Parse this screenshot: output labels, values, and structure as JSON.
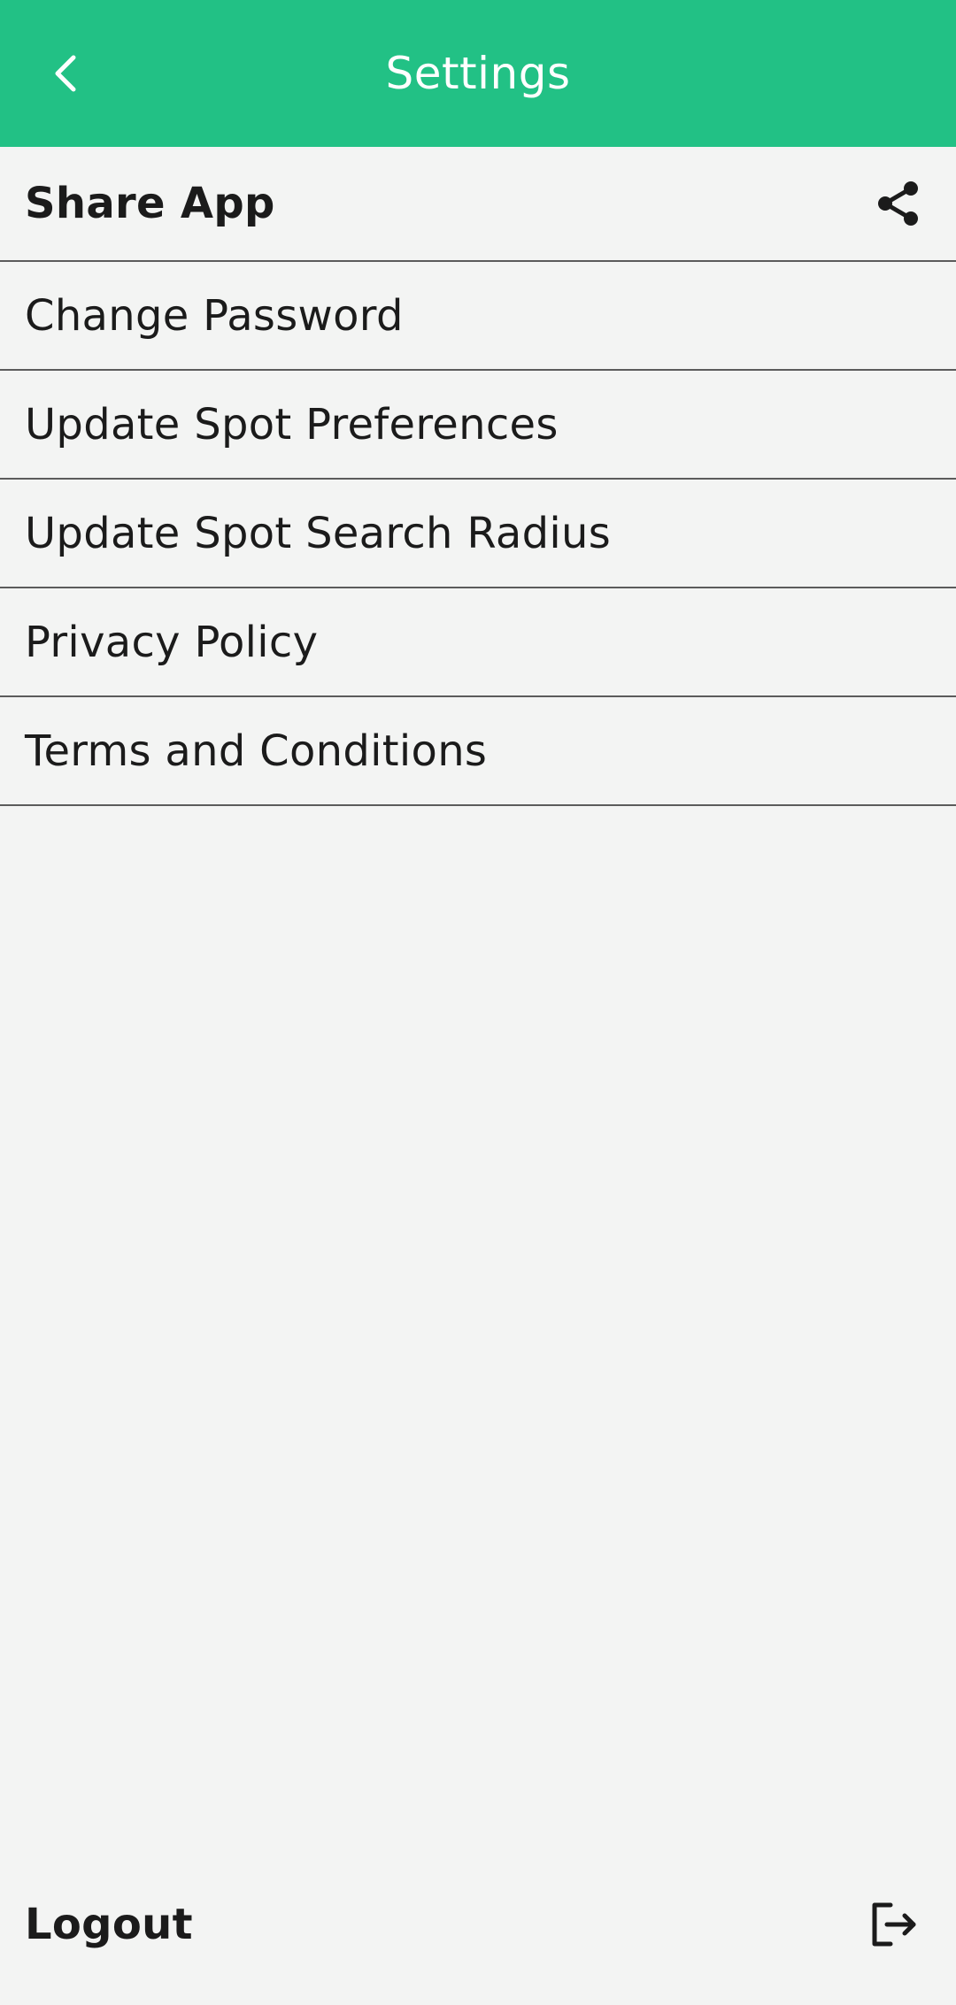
{
  "header": {
    "title": "Settings",
    "back_icon": "chevron-left-icon",
    "background_color": "#22c185"
  },
  "settings": {
    "items": [
      {
        "label": "Share App",
        "icon": "share-icon"
      },
      {
        "label": "Change Password"
      },
      {
        "label": "Update Spot Preferences"
      },
      {
        "label": "Update Spot Search Radius"
      },
      {
        "label": "Privacy Policy"
      },
      {
        "label": "Terms and Conditions"
      }
    ]
  },
  "footer": {
    "logout_label": "Logout",
    "logout_icon": "logout-icon"
  }
}
